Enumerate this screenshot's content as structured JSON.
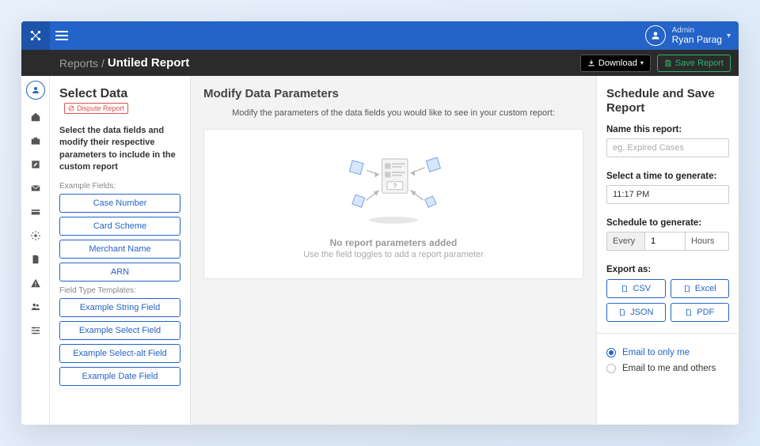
{
  "topbar": {
    "role": "Admin",
    "user_name": "Ryan Parag"
  },
  "subbar": {
    "root": "Reports",
    "current": "Untiled Report",
    "download_label": "Download",
    "save_label": "Save Report"
  },
  "left": {
    "title": "Select Data",
    "dispute_chip": "Dispute Report",
    "helper": "Select the data fields and modify their respective parameters to include in the custom report",
    "example_fields_label": "Example Fields:",
    "example_fields": [
      "Case Number",
      "Card Scheme",
      "Merchant Name",
      "ARN"
    ],
    "template_fields_label": "Field Type Templates:",
    "template_fields": [
      "Example String Field",
      "Example Select Field",
      "Example Select-alt Field",
      "Example Date Field"
    ]
  },
  "center": {
    "title": "Modify Data Parameters",
    "subtitle": "Modify the parameters of the data fields you would like to see in your custom report:",
    "placeholder_title": "No report parameters added",
    "placeholder_sub": "Use the field toggles to add a report parameter"
  },
  "right": {
    "title_line1": "Schedule and Save",
    "title_line2": "Report",
    "name_label": "Name this report:",
    "name_placeholder": "eg. Expired Cases",
    "time_label": "Select a time to generate:",
    "time_value": "11:17 PM",
    "schedule_label": "Schedule to generate:",
    "schedule_every": "Every",
    "schedule_value": "1",
    "schedule_unit": "Hours",
    "export_label": "Export as:",
    "export_options": [
      "CSV",
      "Excel",
      "JSON",
      "PDF"
    ],
    "radio_only_me": "Email to only me",
    "radio_others": "Email to me and others"
  }
}
